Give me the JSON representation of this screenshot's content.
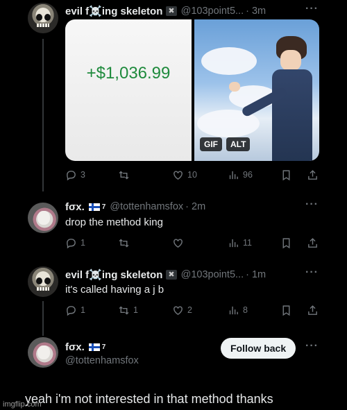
{
  "tweet1": {
    "display_name": "evil f☠️ing skeleton",
    "badge": "✖",
    "handle": "@103point5...",
    "time": "· 3m",
    "media_amount": "+$1,036.99",
    "media_tags": [
      "GIF",
      "ALT"
    ],
    "stats": {
      "reply": "3",
      "retweet": "",
      "like": "10",
      "views": "96"
    }
  },
  "reply1": {
    "display_name": "fσx.",
    "superscript": "7",
    "handle": "@tottenhamsfox",
    "time": "· 2m",
    "text": "drop the method king",
    "stats": {
      "reply": "1",
      "retweet": "",
      "like": "",
      "views": "11"
    }
  },
  "reply2": {
    "display_name": "evil f☠️ing skeleton",
    "badge": "✖",
    "handle": "@103point5...",
    "time": "· 1m",
    "text": "it's called having a j  b",
    "stats": {
      "reply": "1",
      "retweet": "1",
      "like": "2",
      "views": "8"
    }
  },
  "profile": {
    "display_name": "fσx.",
    "superscript": "7",
    "handle": "@tottenhamsfox",
    "follow_label": "Follow back"
  },
  "caption": "yeah i'm not interested in that method thanks",
  "watermark": "imgflip.com",
  "more_label": "···",
  "colors": {
    "background": "#000000",
    "text": "#e7e9ea",
    "muted": "#71767b",
    "money_green": "#1e8a3c"
  },
  "icons": [
    "reply-icon",
    "retweet-icon",
    "like-icon",
    "views-icon",
    "bookmark-icon",
    "share-icon",
    "more-icon"
  ]
}
